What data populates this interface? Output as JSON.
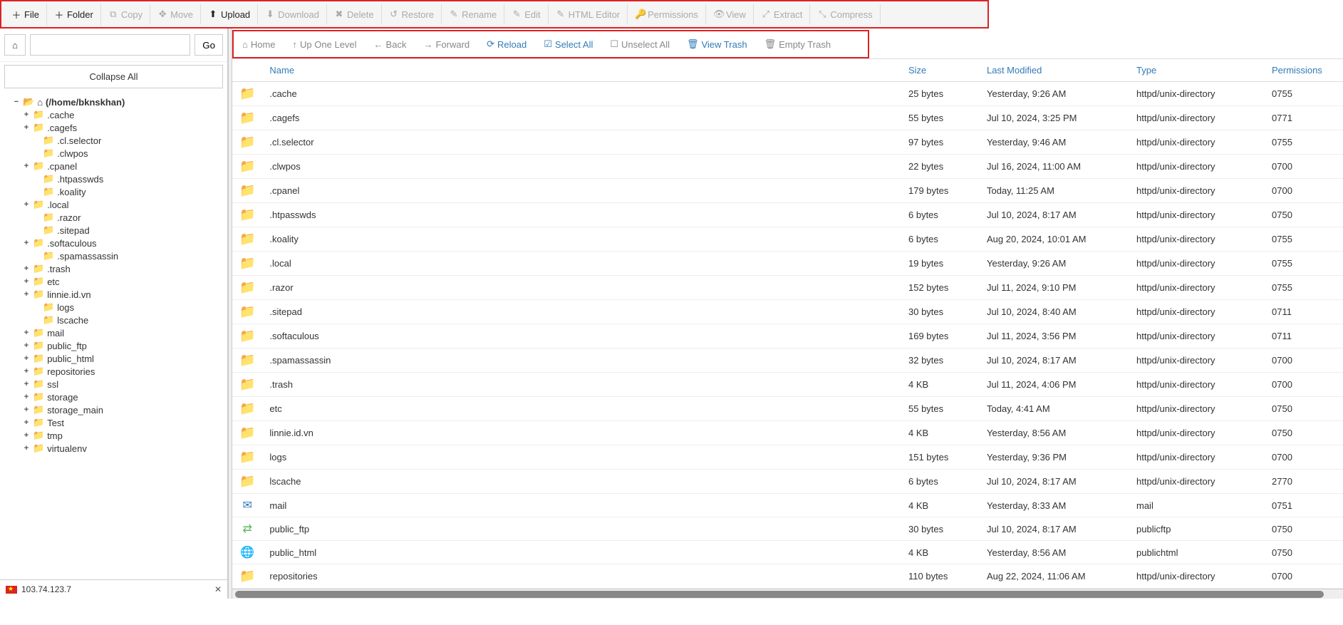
{
  "toolbar_main": {
    "file": "File",
    "folder": "Folder",
    "copy": "Copy",
    "move": "Move",
    "upload": "Upload",
    "download": "Download",
    "delete": "Delete",
    "restore": "Restore",
    "rename": "Rename",
    "edit": "Edit",
    "html_editor": "HTML Editor",
    "permissions": "Permissions",
    "view": "View",
    "extract": "Extract",
    "compress": "Compress"
  },
  "pathbar": {
    "go": "Go",
    "path_value": ""
  },
  "sidebar": {
    "collapse_all": "Collapse All",
    "root_label": "(/home/bknskhan)",
    "items": [
      {
        "label": ".cache",
        "expandable": true,
        "indent": 1
      },
      {
        "label": ".cagefs",
        "expandable": true,
        "indent": 1
      },
      {
        "label": ".cl.selector",
        "expandable": false,
        "indent": 2
      },
      {
        "label": ".clwpos",
        "expandable": false,
        "indent": 2
      },
      {
        "label": ".cpanel",
        "expandable": true,
        "indent": 1
      },
      {
        "label": ".htpasswds",
        "expandable": false,
        "indent": 2
      },
      {
        "label": ".koality",
        "expandable": false,
        "indent": 2
      },
      {
        "label": ".local",
        "expandable": true,
        "indent": 1
      },
      {
        "label": ".razor",
        "expandable": false,
        "indent": 2
      },
      {
        "label": ".sitepad",
        "expandable": false,
        "indent": 2
      },
      {
        "label": ".softaculous",
        "expandable": true,
        "indent": 1
      },
      {
        "label": ".spamassassin",
        "expandable": false,
        "indent": 2
      },
      {
        "label": ".trash",
        "expandable": true,
        "indent": 1
      },
      {
        "label": "etc",
        "expandable": true,
        "indent": 1
      },
      {
        "label": "linnie.id.vn",
        "expandable": true,
        "indent": 1
      },
      {
        "label": "logs",
        "expandable": false,
        "indent": 2
      },
      {
        "label": "lscache",
        "expandable": false,
        "indent": 2
      },
      {
        "label": "mail",
        "expandable": true,
        "indent": 1
      },
      {
        "label": "public_ftp",
        "expandable": true,
        "indent": 1
      },
      {
        "label": "public_html",
        "expandable": true,
        "indent": 1
      },
      {
        "label": "repositories",
        "expandable": true,
        "indent": 1
      },
      {
        "label": "ssl",
        "expandable": true,
        "indent": 1
      },
      {
        "label": "storage",
        "expandable": true,
        "indent": 1
      },
      {
        "label": "storage_main",
        "expandable": true,
        "indent": 1
      },
      {
        "label": "Test",
        "expandable": true,
        "indent": 1
      },
      {
        "label": "tmp",
        "expandable": true,
        "indent": 1
      },
      {
        "label": "virtualenv",
        "expandable": true,
        "indent": 1
      }
    ],
    "status_ip": "103.74.123.7"
  },
  "toolbar_nav": {
    "home": "Home",
    "up": "Up One Level",
    "back": "Back",
    "forward": "Forward",
    "reload": "Reload",
    "select_all": "Select All",
    "unselect_all": "Unselect All",
    "view_trash": "View Trash",
    "empty_trash": "Empty Trash"
  },
  "table": {
    "headers": {
      "name": "Name",
      "size": "Size",
      "last_modified": "Last Modified",
      "type": "Type",
      "permissions": "Permissions"
    },
    "rows": [
      {
        "icon": "folder",
        "name": ".cache",
        "size": "25 bytes",
        "mod": "Yesterday, 9:26 AM",
        "type": "httpd/unix-directory",
        "perm": "0755"
      },
      {
        "icon": "folder",
        "name": ".cagefs",
        "size": "55 bytes",
        "mod": "Jul 10, 2024, 3:25 PM",
        "type": "httpd/unix-directory",
        "perm": "0771"
      },
      {
        "icon": "folder",
        "name": ".cl.selector",
        "size": "97 bytes",
        "mod": "Yesterday, 9:46 AM",
        "type": "httpd/unix-directory",
        "perm": "0755"
      },
      {
        "icon": "folder",
        "name": ".clwpos",
        "size": "22 bytes",
        "mod": "Jul 16, 2024, 11:00 AM",
        "type": "httpd/unix-directory",
        "perm": "0700"
      },
      {
        "icon": "folder",
        "name": ".cpanel",
        "size": "179 bytes",
        "mod": "Today, 11:25 AM",
        "type": "httpd/unix-directory",
        "perm": "0700"
      },
      {
        "icon": "folder",
        "name": ".htpasswds",
        "size": "6 bytes",
        "mod": "Jul 10, 2024, 8:17 AM",
        "type": "httpd/unix-directory",
        "perm": "0750"
      },
      {
        "icon": "folder",
        "name": ".koality",
        "size": "6 bytes",
        "mod": "Aug 20, 2024, 10:01 AM",
        "type": "httpd/unix-directory",
        "perm": "0755"
      },
      {
        "icon": "folder",
        "name": ".local",
        "size": "19 bytes",
        "mod": "Yesterday, 9:26 AM",
        "type": "httpd/unix-directory",
        "perm": "0755"
      },
      {
        "icon": "folder",
        "name": ".razor",
        "size": "152 bytes",
        "mod": "Jul 11, 2024, 9:10 PM",
        "type": "httpd/unix-directory",
        "perm": "0755"
      },
      {
        "icon": "folder",
        "name": ".sitepad",
        "size": "30 bytes",
        "mod": "Jul 10, 2024, 8:40 AM",
        "type": "httpd/unix-directory",
        "perm": "0711"
      },
      {
        "icon": "folder",
        "name": ".softaculous",
        "size": "169 bytes",
        "mod": "Jul 11, 2024, 3:56 PM",
        "type": "httpd/unix-directory",
        "perm": "0711"
      },
      {
        "icon": "folder",
        "name": ".spamassassin",
        "size": "32 bytes",
        "mod": "Jul 10, 2024, 8:17 AM",
        "type": "httpd/unix-directory",
        "perm": "0700"
      },
      {
        "icon": "folder",
        "name": ".trash",
        "size": "4 KB",
        "mod": "Jul 11, 2024, 4:06 PM",
        "type": "httpd/unix-directory",
        "perm": "0700"
      },
      {
        "icon": "folder",
        "name": "etc",
        "size": "55 bytes",
        "mod": "Today, 4:41 AM",
        "type": "httpd/unix-directory",
        "perm": "0750"
      },
      {
        "icon": "folder",
        "name": "linnie.id.vn",
        "size": "4 KB",
        "mod": "Yesterday, 8:56 AM",
        "type": "httpd/unix-directory",
        "perm": "0750"
      },
      {
        "icon": "folder",
        "name": "logs",
        "size": "151 bytes",
        "mod": "Yesterday, 9:36 PM",
        "type": "httpd/unix-directory",
        "perm": "0700"
      },
      {
        "icon": "folder",
        "name": "lscache",
        "size": "6 bytes",
        "mod": "Jul 10, 2024, 8:17 AM",
        "type": "httpd/unix-directory",
        "perm": "2770"
      },
      {
        "icon": "mail",
        "name": "mail",
        "size": "4 KB",
        "mod": "Yesterday, 8:33 AM",
        "type": "mail",
        "perm": "0751"
      },
      {
        "icon": "sync",
        "name": "public_ftp",
        "size": "30 bytes",
        "mod": "Jul 10, 2024, 8:17 AM",
        "type": "publicftp",
        "perm": "0750"
      },
      {
        "icon": "globe",
        "name": "public_html",
        "size": "4 KB",
        "mod": "Yesterday, 8:56 AM",
        "type": "publichtml",
        "perm": "0750"
      },
      {
        "icon": "folder",
        "name": "repositories",
        "size": "110 bytes",
        "mod": "Aug 22, 2024, 11:06 AM",
        "type": "httpd/unix-directory",
        "perm": "0700"
      }
    ]
  }
}
